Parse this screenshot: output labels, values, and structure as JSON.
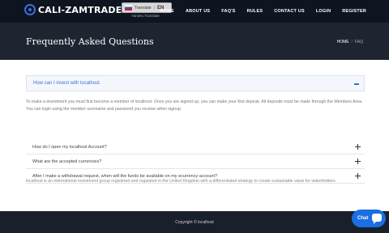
{
  "header": {
    "logo_text": "CALI-ZAMTRADE",
    "translate": {
      "label": "Translate",
      "lang": "EN",
      "caption": "Yandex.Translate"
    },
    "nav": [
      "HOME",
      "ABOUT US",
      "FAQ'S",
      "RULES",
      "CONTACT US",
      "LOGIN",
      "REGISTER"
    ]
  },
  "banner": {
    "title": "Frequently Asked Questions",
    "breadcrumb": {
      "home": "HOME",
      "sep": "/",
      "current": "FAQ"
    }
  },
  "faq": {
    "open_question": "How can I invest with localhost.",
    "open_answer": "To make a investment you must first become a member of localhost. Once you are signed up, you can make your first deposit. All deposits must be made through the Members Area. You can login using the member username and password you receive when signup.",
    "questions": [
      "How do I open my localhost Account?",
      "What are the accepted currencies?",
      "After I make a withdrawal request, when will the funds be available on my ecurrency account?"
    ]
  },
  "about_text": "localhost is an international investment group registered and regulated in the United Kingdom with a differentiated strategy to create sustainable value for stakeholders.",
  "footer": {
    "copyright": "Copyright © localhost"
  },
  "chat": {
    "label": "Chat"
  },
  "colors": {
    "header_bg": "#0e1420",
    "banner_bg": "#1e2530",
    "accent": "#3b6fd8",
    "chat": "#1a6fe3"
  }
}
